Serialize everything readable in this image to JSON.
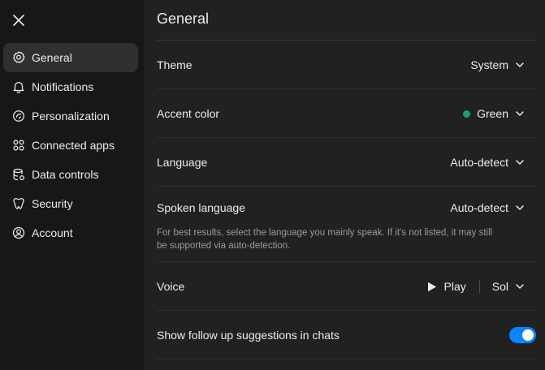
{
  "sidebar": {
    "close_icon": "close-icon",
    "items": [
      {
        "label": "General",
        "icon": "gear-icon",
        "active": true
      },
      {
        "label": "Notifications",
        "icon": "bell-icon"
      },
      {
        "label": "Personalization",
        "icon": "personalization-icon"
      },
      {
        "label": "Connected apps",
        "icon": "apps-icon"
      },
      {
        "label": "Data controls",
        "icon": "database-icon"
      },
      {
        "label": "Security",
        "icon": "shield-icon"
      },
      {
        "label": "Account",
        "icon": "user-icon"
      }
    ]
  },
  "main": {
    "title": "General",
    "theme": {
      "label": "Theme",
      "value": "System"
    },
    "accent": {
      "label": "Accent color",
      "value": "Green",
      "color": "#10a37f"
    },
    "language": {
      "label": "Language",
      "value": "Auto-detect"
    },
    "spoken_language": {
      "label": "Spoken language",
      "value": "Auto-detect",
      "helper": "For best results, select the language you mainly speak. If it's not listed, it may still be supported via auto-detection."
    },
    "voice": {
      "label": "Voice",
      "play_label": "Play",
      "value": "Sol"
    },
    "followups": {
      "label": "Show follow up suggestions in chats",
      "enabled": true,
      "toggle_color": "#0a84ff"
    }
  }
}
